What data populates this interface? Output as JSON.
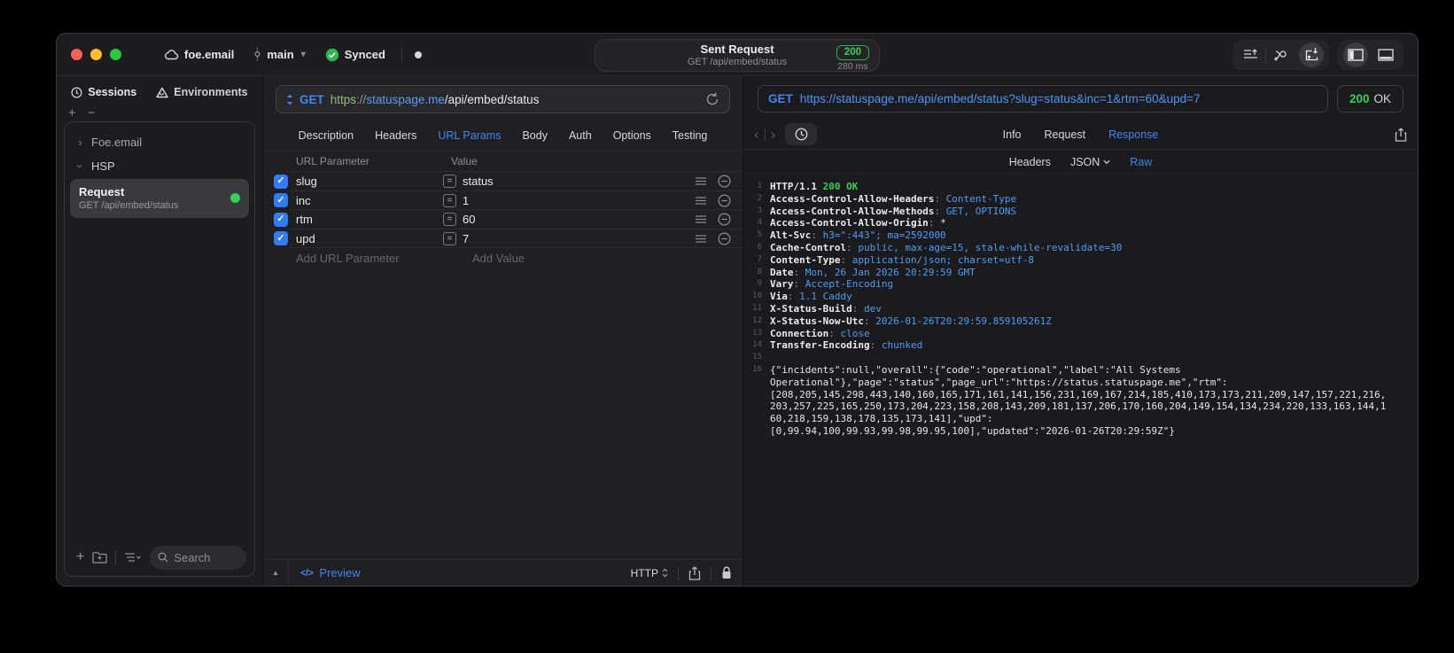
{
  "titlebar": {
    "project": "foe.email",
    "branch": "main",
    "sync_status": "Synced",
    "center": {
      "title": "Sent Request",
      "subtitle": "GET /api/embed/status",
      "status_code": "200",
      "duration": "280 ms"
    }
  },
  "sidebar": {
    "tabs": [
      {
        "label": "Sessions",
        "icon": "history-clock-icon"
      },
      {
        "label": "Environments",
        "icon": "environments-icon"
      }
    ],
    "active_tab": "Sessions",
    "tree": [
      {
        "label": "Foe.email",
        "expanded": false
      },
      {
        "label": "HSP",
        "expanded": true
      }
    ],
    "request_item": {
      "title": "Request",
      "subtitle": "GET /api/embed/status",
      "status_dot_color": "#30d158"
    },
    "search_placeholder": "Search"
  },
  "request_panel": {
    "method": "GET",
    "url": {
      "scheme": "https",
      "separator": "://",
      "host": "statuspage.me",
      "path": "/api/embed/status"
    },
    "tabs": [
      "Description",
      "Headers",
      "URL Params",
      "Body",
      "Auth",
      "Options",
      "Testing"
    ],
    "active_tab": "URL Params",
    "params_table": {
      "columns": [
        "URL Parameter",
        "Value"
      ],
      "rows": [
        {
          "name": "slug",
          "value": "status",
          "checked": true
        },
        {
          "name": "inc",
          "value": "1",
          "checked": true
        },
        {
          "name": "rtm",
          "value": "60",
          "checked": true
        },
        {
          "name": "upd",
          "value": "7",
          "checked": true
        }
      ],
      "add_parameter_placeholder": "Add URL Parameter",
      "add_value_placeholder": "Add Value"
    },
    "footer": {
      "code_glyph": "</>",
      "preview_label": "Preview",
      "protocol": "HTTP"
    }
  },
  "response_panel": {
    "method": "GET",
    "url": "https://statuspage.me/api/embed/status?slug=status&inc=1&rtm=60&upd=7",
    "status_code": "200",
    "status_text": "OK",
    "tabs": [
      "Info",
      "Request",
      "Response"
    ],
    "active_tab": "Response",
    "subtabs": [
      "Headers",
      "JSON",
      "Raw"
    ],
    "active_subtab": "Raw",
    "body_lines": [
      {
        "num": "1",
        "parts": [
          {
            "t": "HTTP/1.1 ",
            "c": "name"
          },
          {
            "t": "200 OK",
            "c": "green"
          }
        ]
      },
      {
        "num": "2",
        "parts": [
          {
            "t": "Access-Control-Allow-Headers",
            "c": "name"
          },
          {
            "t": ": ",
            "c": "dim"
          },
          {
            "t": "Content-Type",
            "c": "blue"
          }
        ]
      },
      {
        "num": "3",
        "parts": [
          {
            "t": "Access-Control-Allow-Methods",
            "c": "name"
          },
          {
            "t": ": ",
            "c": "dim"
          },
          {
            "t": "GET, OPTIONS",
            "c": "blue"
          }
        ]
      },
      {
        "num": "4",
        "parts": [
          {
            "t": "Access-Control-Allow-Origin",
            "c": "name"
          },
          {
            "t": ": ",
            "c": "dim"
          },
          {
            "t": "*",
            "c": "plain"
          }
        ]
      },
      {
        "num": "5",
        "parts": [
          {
            "t": "Alt-Svc",
            "c": "name"
          },
          {
            "t": ": ",
            "c": "dim"
          },
          {
            "t": "h3=\":443\"; ma=2592000",
            "c": "blue"
          }
        ]
      },
      {
        "num": "6",
        "parts": [
          {
            "t": "Cache-Control",
            "c": "name"
          },
          {
            "t": ": ",
            "c": "dim"
          },
          {
            "t": "public, max-age=15, stale-while-revalidate=30",
            "c": "blue"
          }
        ]
      },
      {
        "num": "7",
        "parts": [
          {
            "t": "Content-Type",
            "c": "name"
          },
          {
            "t": ": ",
            "c": "dim"
          },
          {
            "t": "application/json; charset=utf-8",
            "c": "blue"
          }
        ]
      },
      {
        "num": "8",
        "parts": [
          {
            "t": "Date",
            "c": "name"
          },
          {
            "t": ": ",
            "c": "dim"
          },
          {
            "t": "Mon, 26 Jan 2026 20:29:59 GMT",
            "c": "blue"
          }
        ]
      },
      {
        "num": "9",
        "parts": [
          {
            "t": "Vary",
            "c": "name"
          },
          {
            "t": ": ",
            "c": "dim"
          },
          {
            "t": "Accept-Encoding",
            "c": "blue"
          }
        ]
      },
      {
        "num": "10",
        "parts": [
          {
            "t": "Via",
            "c": "name"
          },
          {
            "t": ": ",
            "c": "dim"
          },
          {
            "t": "1.1 Caddy",
            "c": "blue"
          }
        ]
      },
      {
        "num": "11",
        "parts": [
          {
            "t": "X-Status-Build",
            "c": "name"
          },
          {
            "t": ": ",
            "c": "dim"
          },
          {
            "t": "dev",
            "c": "blue"
          }
        ]
      },
      {
        "num": "12",
        "parts": [
          {
            "t": "X-Status-Now-Utc",
            "c": "name"
          },
          {
            "t": ": ",
            "c": "dim"
          },
          {
            "t": "2026-01-26T20:29:59.859105261Z",
            "c": "blue"
          }
        ]
      },
      {
        "num": "13",
        "parts": [
          {
            "t": "Connection",
            "c": "name"
          },
          {
            "t": ": ",
            "c": "dim"
          },
          {
            "t": "close",
            "c": "blue"
          }
        ]
      },
      {
        "num": "14",
        "parts": [
          {
            "t": "Transfer-Encoding",
            "c": "name"
          },
          {
            "t": ": ",
            "c": "dim"
          },
          {
            "t": "chunked",
            "c": "blue"
          }
        ]
      },
      {
        "num": "15",
        "parts": []
      },
      {
        "num": "16",
        "parts": [
          {
            "t": "{\"incidents\":null,\"overall\":{\"code\":\"operational\",\"label\":\"All Systems",
            "c": "plain"
          }
        ]
      },
      {
        "num": "",
        "parts": [
          {
            "t": "Operational\"},\"page\":\"status\",\"page_url\":\"https://status.statuspage.me\",\"rtm\":",
            "c": "plain"
          }
        ]
      },
      {
        "num": "",
        "parts": [
          {
            "t": "[208,205,145,298,443,140,160,165,171,161,141,156,231,169,167,214,185,410,173,173,211,209,147,157,221,216,",
            "c": "plain"
          }
        ]
      },
      {
        "num": "",
        "parts": [
          {
            "t": "203,257,225,165,250,173,204,223,158,208,143,209,181,137,206,170,160,204,149,154,134,234,220,133,163,144,1",
            "c": "plain"
          }
        ]
      },
      {
        "num": "",
        "parts": [
          {
            "t": "60,218,159,138,178,135,173,141],\"upd\":",
            "c": "plain"
          }
        ]
      },
      {
        "num": "",
        "parts": [
          {
            "t": "[0,99.94,100,99.93,99.98,99.95,100],\"updated\":\"2026-01-26T20:29:59Z\"}",
            "c": "plain"
          }
        ]
      }
    ]
  },
  "icons": {
    "cloud-icon": "cloud",
    "branch-icon": "commit-node",
    "synced-check-icon": "check-circle",
    "changes-dot": "filled-dot",
    "request-queue-icon": "lines-arrow-up",
    "merge-icon": "merge-arrows",
    "import-icon": "box-with-arrows",
    "sidebar-toggle-icon": "panel-left",
    "bottom-panel-toggle-icon": "panel-bottom",
    "history-clock-icon": "clock",
    "environments-icon": "triangle",
    "add-icon": "plus",
    "remove-icon": "minus",
    "new-folder-icon": "folder-plus",
    "list-options-icon": "list-chevron",
    "search-icon": "magnifier",
    "refresh-icon": "circular-arrow",
    "collapse-icon": "triangle-up",
    "code-icon": "angle-brackets",
    "share-icon": "square-arrow-up",
    "lock-icon": "padlock",
    "reorder-icon": "hamburger-lines",
    "delete-param-icon": "circle-minus",
    "back-icon": "chevron-left",
    "forward-icon": "chevron-right"
  },
  "colors": {
    "accent_blue": "#3f86f6",
    "link_blue": "#4b96f8",
    "success_green": "#32d158",
    "traffic_red": "#ff5f57",
    "traffic_yellow": "#febc2e",
    "traffic_green": "#28c840",
    "window_bg": "#1d1d1f",
    "selection_bg": "#3a3a3e"
  }
}
